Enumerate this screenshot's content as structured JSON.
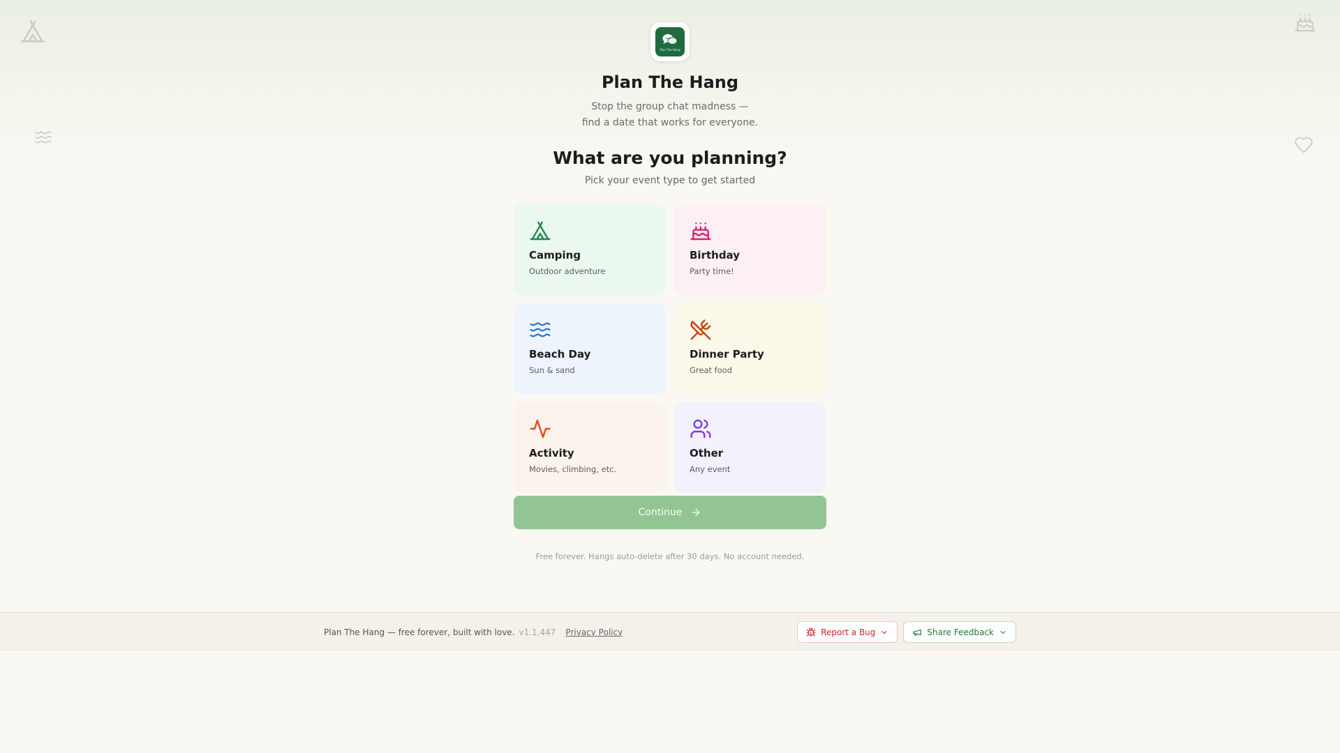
{
  "app": {
    "title": "Plan The Hang",
    "logo_text": "Plan The Hang",
    "tagline_line1": "Stop the group chat madness —",
    "tagline_line2": "find a date that works for everyone."
  },
  "prompt": {
    "heading": "What are you planning?",
    "subheading": "Pick your event type to get started"
  },
  "event_types": [
    {
      "id": "camping",
      "label": "Camping",
      "description": "Outdoor adventure",
      "icon": "tent-icon",
      "bg": "#eaf8f0",
      "color": "#1f8a4c"
    },
    {
      "id": "birthday",
      "label": "Birthday",
      "description": "Party time!",
      "icon": "cake-icon",
      "bg": "#fcf0f5",
      "color": "#d6246e"
    },
    {
      "id": "beach",
      "label": "Beach Day",
      "description": "Sun & sand",
      "icon": "waves-icon",
      "bg": "#edf4fc",
      "color": "#2b7bc9"
    },
    {
      "id": "dinner",
      "label": "Dinner Party",
      "description": "Great food",
      "icon": "utensils-crossed-icon",
      "bg": "#fcf9ea",
      "color": "#c2410c"
    },
    {
      "id": "activity",
      "label": "Activity",
      "description": "Movies, climbing, etc.",
      "icon": "activity-icon",
      "bg": "#fcf3ec",
      "color": "#ea4a12"
    },
    {
      "id": "other",
      "label": "Other",
      "description": "Any event",
      "icon": "users-icon",
      "bg": "#f3f1fb",
      "color": "#7c3aed"
    }
  ],
  "actions": {
    "continue_label": "Continue"
  },
  "fineprint": "Free forever. Hangs auto-delete after 30 days. No account needed.",
  "footer": {
    "credit": "Plan The Hang — free forever, built with love.",
    "version": "v1.1.447",
    "privacy_label": "Privacy Policy",
    "report_bug_label": "Report a Bug",
    "share_feedback_label": "Share Feedback"
  },
  "colors": {
    "primary_disabled": "#93c493",
    "brand_green": "#1f6b3f",
    "bug_red": "#c5282b",
    "feedback_green": "#1e7a3a"
  }
}
